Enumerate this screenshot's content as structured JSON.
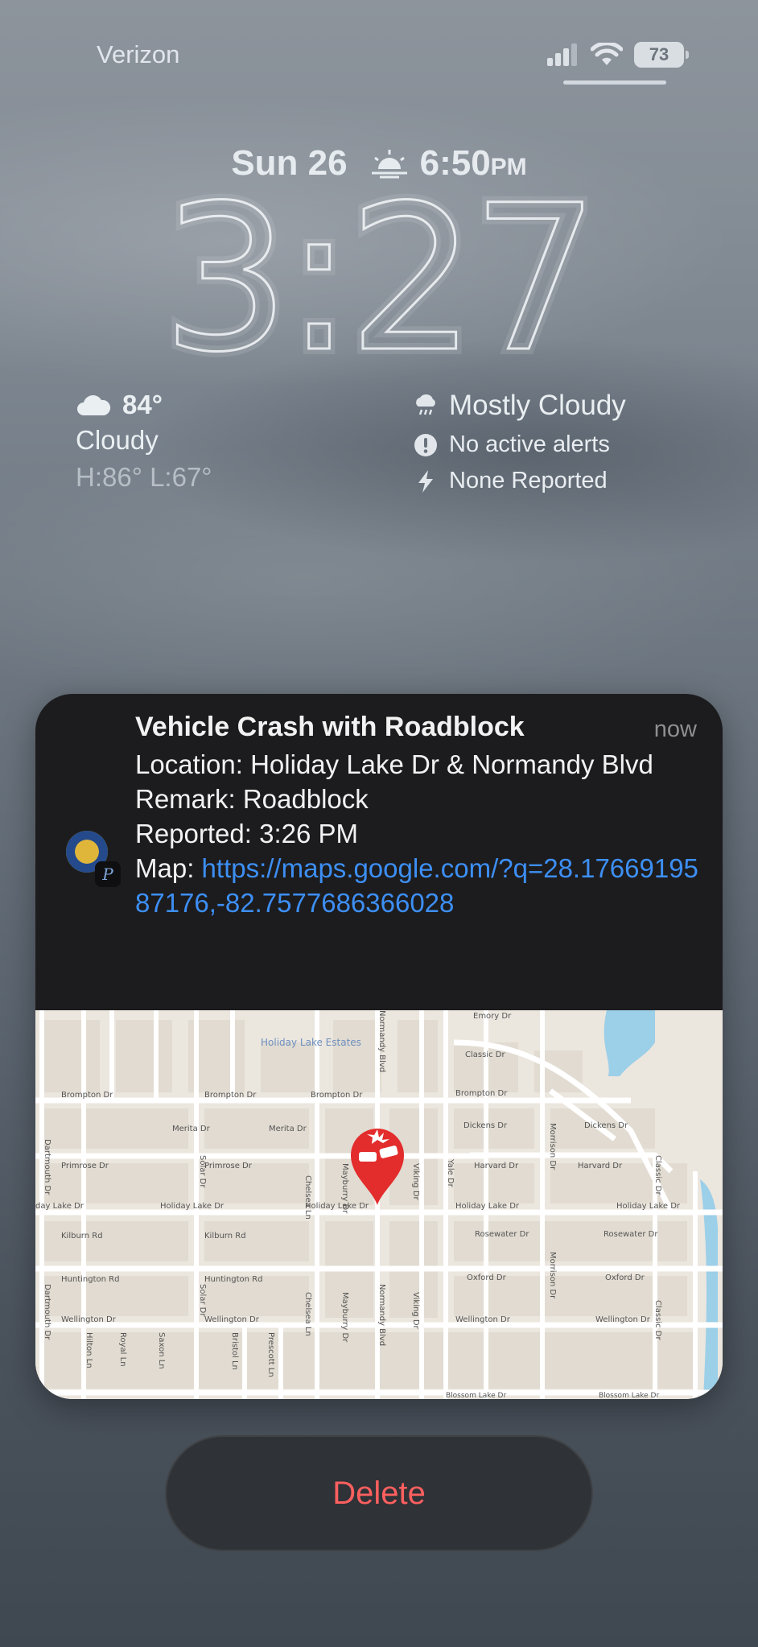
{
  "status_bar": {
    "carrier": "Verizon",
    "battery": "73",
    "signal_icon": "cellular-signal-icon",
    "wifi_icon": "wifi-icon"
  },
  "lock_screen": {
    "date": "Sun 26",
    "sunset_icon": "sunset-icon",
    "sunset_time": "6:50",
    "sunset_suffix": "PM",
    "time": "3:27",
    "weather_left": {
      "icon": "cloud-icon",
      "temp": "84°",
      "condition": "Cloudy",
      "high_low": "H:86° L:67°"
    },
    "weather_right": {
      "forecast": "Mostly Cloudy",
      "alerts": "No active alerts",
      "lightning": "None Reported"
    }
  },
  "notification": {
    "title": "Vehicle Crash with Roadblock",
    "time": "now",
    "location_line": "Location: Holiday Lake Dr & Normandy Blvd",
    "remark_line": "Remark: Roadblock",
    "reported_line": "Reported: 3:26 PM",
    "map_label": "Map: ",
    "map_link": "https://maps.google.com/?q=28.1766919587176,-82.7577686366028",
    "app_badge": "P"
  },
  "map": {
    "neighborhood": "Holiday Lake Estates",
    "pin_icon": "car-crash-pin-icon",
    "streets": {
      "emory": "Emory Dr",
      "classic": "Classic Dr",
      "brompton": "Brompton Dr",
      "merita": "Merita Dr",
      "dickens": "Dickens Dr",
      "primrose": "Primrose Dr",
      "harvard": "Harvard Dr",
      "holiday_lake": "Holiday Lake Dr",
      "day_lake": "day Lake Dr",
      "kilburn": "Kilburn Rd",
      "rosewater": "Rosewater Dr",
      "huntington": "Huntington Rd",
      "oxford": "Oxford Dr",
      "wellington": "Wellington Dr",
      "blossom": "Blossom Lake Dr",
      "chelsea": "Chelsea Ln",
      "mayburry": "Mayburry Dr",
      "viking": "Viking Dr",
      "yale": "Yale Dr",
      "morrison": "Morrison Dr",
      "normandy": "Normandy Blvd",
      "solar": "Solar Dr",
      "dartmouth": "Dartmouth Dr",
      "prescott": "Prescott Ln",
      "bristol": "Bristol Ln",
      "hilton": "Hilton Ln",
      "saxon": "Saxon Ln",
      "royal": "Royal Ln",
      "blossom_sm": "Blossom Lake Dr"
    }
  },
  "actions": {
    "delete": "Delete"
  }
}
